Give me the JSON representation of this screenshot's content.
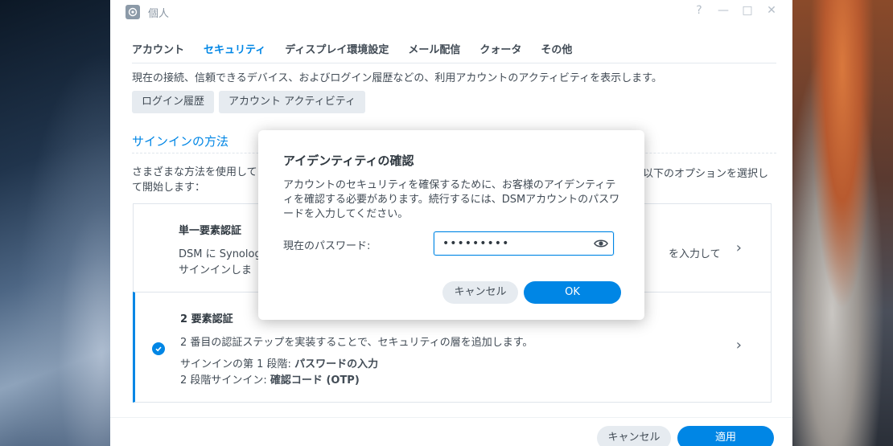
{
  "window": {
    "title": "個人",
    "controls": {
      "help": "?",
      "minimize": "—",
      "maximize": "□",
      "close": "✕"
    }
  },
  "tabs": [
    {
      "label": "アカウント",
      "active": false
    },
    {
      "label": "セキュリティ",
      "active": true
    },
    {
      "label": "ディスプレイ環境設定",
      "active": false
    },
    {
      "label": "メール配信",
      "active": false
    },
    {
      "label": "クォータ",
      "active": false
    },
    {
      "label": "その他",
      "active": false
    }
  ],
  "security": {
    "description": "現在の接続、信頼できるデバイス、およびログイン履歴などの、利用アカウントのアクティビティを表示します。",
    "buttons": {
      "login_history": "ログイン履歴",
      "account_activity": "アカウント アクティビティ"
    },
    "signin_section_title": "サインインの方法",
    "signin_desc_left": "さまざまな方法を使用して",
    "signin_desc_right": "以下のオプションを選択し",
    "signin_desc_line2": "て開始します：",
    "options": [
      {
        "title": "単一要素認証",
        "line1_left": "DSM に Synolog",
        "line1_right": "を入力して",
        "line2": "サインインしま"
      },
      {
        "title": "2 要素認証",
        "line1": "2 番目の認証ステップを実装することで、セキュリティの層を追加します。",
        "line2_label": "サインインの第 1 段階: ",
        "line2_value": "パスワードの入力",
        "line3_label": "2 段階サインイン: ",
        "line3_value": "確認コード (OTP)",
        "selected": true
      }
    ]
  },
  "footer": {
    "cancel": "キャンセル",
    "apply": "適用"
  },
  "modal": {
    "title": "アイデンティティの確認",
    "text": "アカウントのセキュリティを確保するために、お客様のアイデンティティを確認する必要があります。続行するには、DSMアカウントのパスワードを入力してください。",
    "password_label": "現在のパスワード:",
    "password_value": "•••••••••",
    "cancel": "キャンセル",
    "ok": "OK"
  },
  "colors": {
    "accent": "#0086e5",
    "text": "#414b55",
    "button_gray": "#e6ebf0"
  }
}
